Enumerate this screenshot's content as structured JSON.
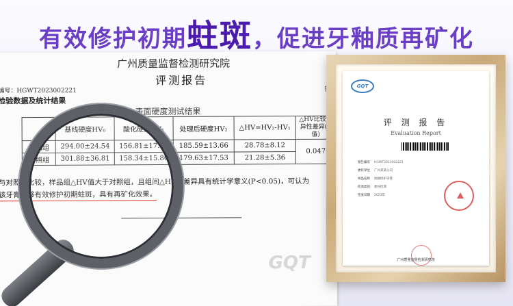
{
  "headline": {
    "pre": "有效修护初期",
    "highlight": "蛀斑",
    "post": "，促进牙釉质再矿化"
  },
  "report": {
    "institute": "广州质量监督检测研究院",
    "title": "评测报告",
    "number": "编号：HGWT2023002221",
    "page": "第",
    "section": "检验数据及统计结果",
    "table_caption": "表面硬度测试结果",
    "table_headers": [
      "",
      "基线硬度HV₀",
      "酸化硬度HV₁",
      "处理后硬度HV₂",
      "△HV=HV₂-HV₁",
      "△HV比较差异性差异(P值)"
    ],
    "table_rows": [
      [
        "样品组",
        "294.00±24.54",
        "156.81±17.67",
        "185.59±13.66",
        "28.78±8.12",
        "0.047"
      ],
      [
        "对照组",
        "301.88±36.81",
        "158.34±15.80",
        "179.63±17.53",
        "21.28±5.36",
        ""
      ]
    ],
    "conclusion_line1": "与对照组比较，样品组△HV值大于对照组，且组间△HV值差异具有统计学意义(P<0.05)，可认为",
    "conclusion_line2": "该牙膏能够有效修护初期蛀斑，具有再矿化效果。",
    "watermark": "GQT"
  },
  "certificate": {
    "logo": "GQT",
    "title": "评 测 报 告",
    "subtitle": "Evaluation Report",
    "rows": [
      {
        "label": "报告编号",
        "value": "HGWT2023002221"
      },
      {
        "label": "委托单位",
        "value": "广州某某公司"
      },
      {
        "label": "样品名称",
        "value": "抗敏修护牙膏"
      },
      {
        "label": "检测类别",
        "value": "委托检测"
      },
      {
        "label": "签发日期",
        "value": "2023年"
      }
    ],
    "footer": "广州质量监督检测研究院"
  },
  "icons": {
    "magnifier": "magnifier-icon",
    "seal": "red-seal-icon"
  }
}
